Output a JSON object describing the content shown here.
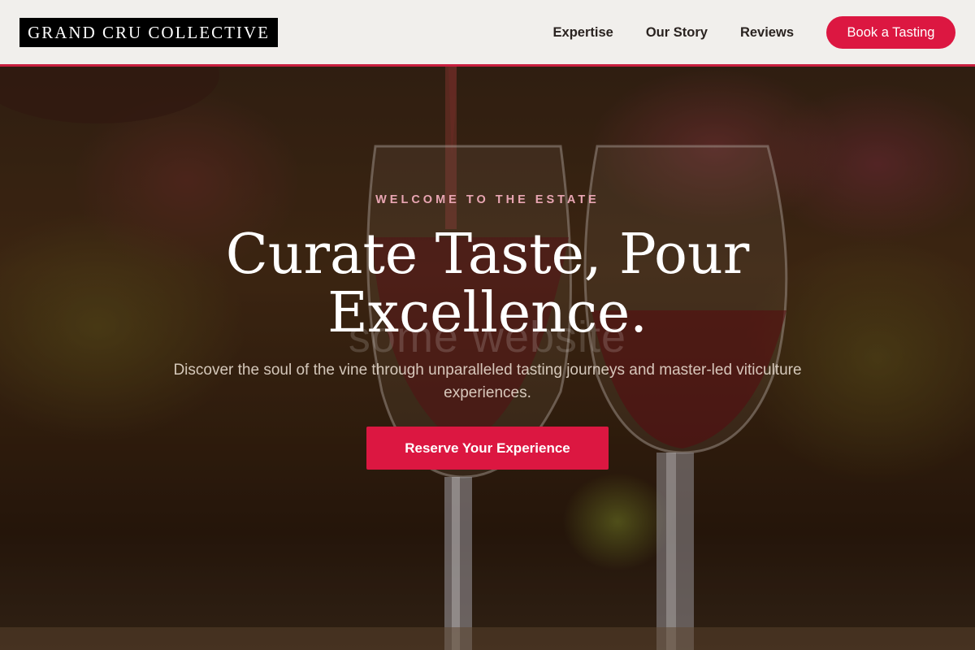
{
  "header": {
    "logo_text": "GRAND CRU COLLECTIVE",
    "nav": [
      {
        "label": "Expertise"
      },
      {
        "label": "Our Story"
      },
      {
        "label": "Reviews"
      }
    ],
    "cta_label": "Book a Tasting"
  },
  "hero": {
    "eyebrow": "WELCOME TO THE ESTATE",
    "headline_line1": "Curate Taste, Pour",
    "headline_line2": "Excellence.",
    "watermark": "some website",
    "subtext": "Discover the soul of the vine through unparalleled tasting journeys and master-led viticulture experiences.",
    "cta_label": "Reserve Your Experience",
    "background_description_icon": "wine-glasses-photo"
  },
  "colors": {
    "accent": "#dc1741",
    "header_bg": "#f1efec",
    "eyebrow": "#e9a6b3"
  }
}
